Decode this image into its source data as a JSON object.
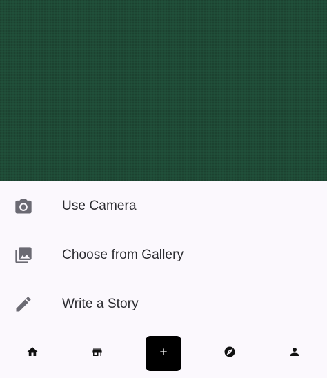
{
  "colors": {
    "scrim": "#1f4a36",
    "sheet_background": "#fbf8fd",
    "icon": "#6b6a73",
    "text": "#2b2b30",
    "fab_background": "#000000",
    "fab_icon": "#ffffff",
    "nav_icon": "#111111"
  },
  "sheet": {
    "options": [
      {
        "label": "Use Camera",
        "icon": "camera-icon"
      },
      {
        "label": "Choose from Gallery",
        "icon": "photo-library-icon"
      },
      {
        "label": "Write a Story",
        "icon": "pencil-icon"
      }
    ]
  },
  "bottom_nav": {
    "items": [
      {
        "icon": "home-icon"
      },
      {
        "icon": "store-icon"
      },
      {
        "icon": "add-icon"
      },
      {
        "icon": "compass-icon"
      },
      {
        "icon": "person-icon"
      }
    ]
  }
}
